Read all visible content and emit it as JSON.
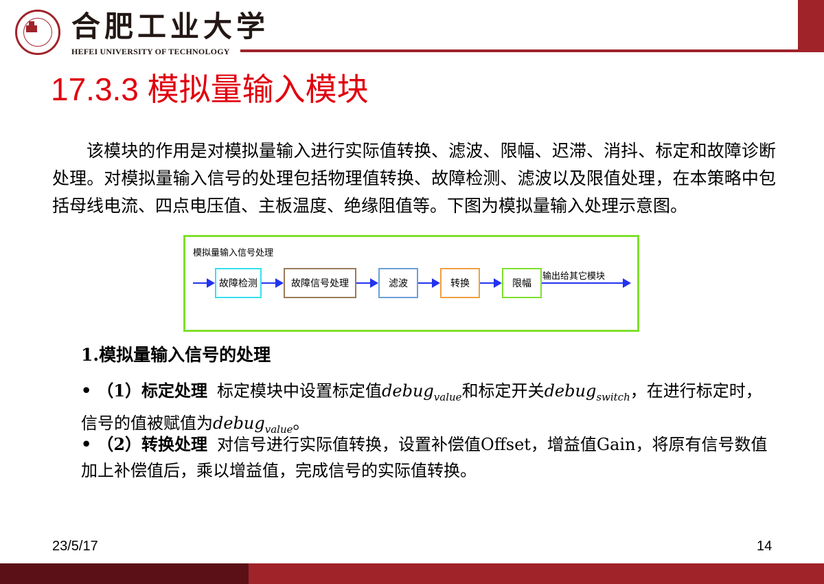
{
  "header": {
    "university_cn": "合肥工业大学",
    "university_en": "HEFEI UNIVERSITY OF TECHNOLOGY",
    "accent_color": "#a0232a"
  },
  "slide": {
    "title": "17.3.3  模拟量输入模块",
    "title_color": "#e0000e",
    "paragraph": "该模块的作用是对模拟量输入进行实际值转换、滤波、限幅、迟滞、消抖、标定和故障诊断处理。对模拟量输入信号的处理包括物理值转换、故障检测、滤波以及限值处理，在本策略中包括母线电流、四点电压值、主板温度、绝缘阻值等。下图为模拟量输入处理示意图。"
  },
  "diagram": {
    "caption": "模拟量输入信号处理",
    "boxes": [
      {
        "label": "故障检测",
        "color": "#33e0f0"
      },
      {
        "label": "故障信号处理",
        "color": "#9a7a5a"
      },
      {
        "label": "滤波",
        "color": "#6aa0d8"
      },
      {
        "label": "转换",
        "color": "#f0a040"
      },
      {
        "label": "限幅",
        "color": "#7ee02b"
      }
    ],
    "output_label": "输出给其它模块",
    "frame_color": "#7ee02b",
    "arrow_color": "#2233ee"
  },
  "section": {
    "heading": "1.模拟量输入信号的处理",
    "bullets": [
      {
        "marker": "•",
        "lead": "（1）标定处理",
        "text_1": "标定模块中设置标定值",
        "math_1_base": "debug",
        "math_1_sub": "value",
        "text_2": "和标定开关",
        "math_2_base": "debug",
        "math_2_sub": "switch",
        "text_3": "，在进行标定时，信号的值被赋值为",
        "math_3_base": "debug",
        "math_3_sub": "value",
        "text_4": "。"
      },
      {
        "marker": "•",
        "lead": "（2）转换处理",
        "text": "对信号进行实际值转换，设置补偿值Offset，增益值Gain，将原有信号数值加上补偿值后，乘以增益值，完成信号的实际值转换。"
      }
    ]
  },
  "footer": {
    "date": "23/5/17",
    "page": "14"
  }
}
